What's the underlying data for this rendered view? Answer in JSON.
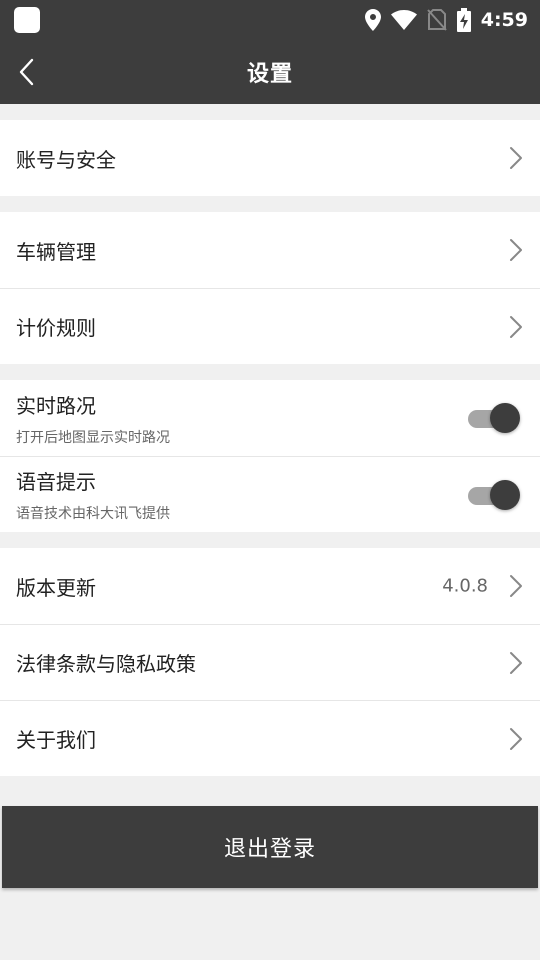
{
  "status_bar": {
    "time": "4:59",
    "icons": [
      "app-icon",
      "location-icon",
      "wifi-icon",
      "no-sim-icon",
      "battery-charging-icon"
    ]
  },
  "header": {
    "title": "设置",
    "back_icon": "chevron-left-icon"
  },
  "groups": {
    "account": {
      "label": "账号与安全"
    },
    "vehicle": {
      "label": "车辆管理"
    },
    "pricing": {
      "label": "计价规则"
    },
    "traffic": {
      "label": "实时路况",
      "sub": "打开后地图显示实时路况",
      "enabled": true
    },
    "voice": {
      "label": "语音提示",
      "sub": "语音技术由科大讯飞提供",
      "enabled": true
    },
    "version": {
      "label": "版本更新",
      "value": "4.0.8"
    },
    "legal": {
      "label": "法律条款与隐私政策"
    },
    "about": {
      "label": "关于我们"
    }
  },
  "logout": {
    "label": "退出登录"
  },
  "colors": {
    "header_bg": "#3d3d3d",
    "page_bg": "#f0f0f0",
    "toggle_track": "#a6a6a6",
    "toggle_thumb": "#3d3d3d"
  }
}
